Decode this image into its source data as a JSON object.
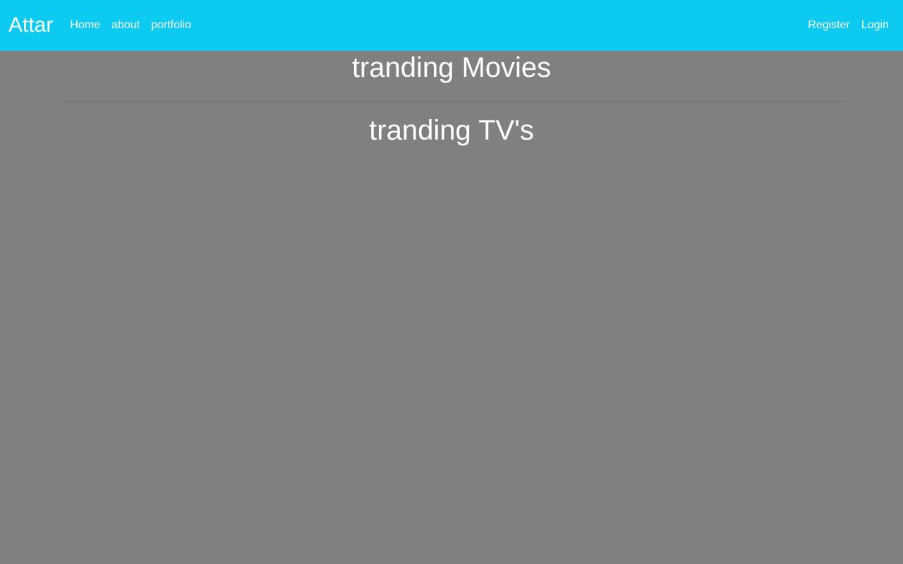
{
  "navbar": {
    "brand": "Attar",
    "left_links": [
      "Home",
      "about",
      "portfolio"
    ],
    "right_links": [
      "Register",
      "Login"
    ]
  },
  "main": {
    "movies_title": "tranding Movies",
    "tv_title": "tranding TV's"
  },
  "colors": {
    "navbar_bg": "#0dcaf0",
    "page_bg": "#808080",
    "text": "#ffffff"
  }
}
